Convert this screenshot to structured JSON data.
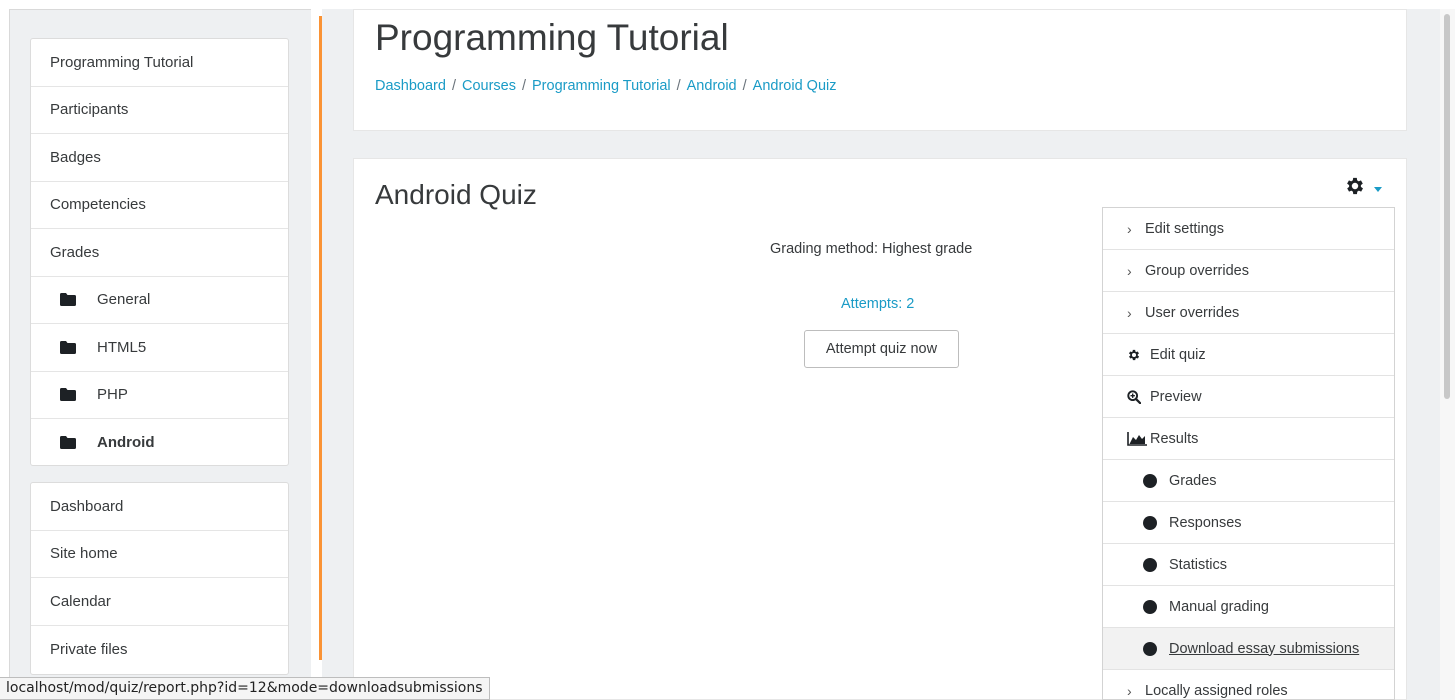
{
  "sidebar": {
    "course_items": [
      {
        "label": "Programming Tutorial",
        "type": "link"
      },
      {
        "label": "Participants",
        "type": "link"
      },
      {
        "label": "Badges",
        "type": "link"
      },
      {
        "label": "Competencies",
        "type": "link"
      },
      {
        "label": "Grades",
        "type": "link"
      },
      {
        "label": "General",
        "type": "folder"
      },
      {
        "label": "HTML5",
        "type": "folder"
      },
      {
        "label": "PHP",
        "type": "folder"
      },
      {
        "label": "Android",
        "type": "folder",
        "active": true
      }
    ],
    "site_items": [
      {
        "label": "Dashboard"
      },
      {
        "label": "Site home"
      },
      {
        "label": "Calendar"
      },
      {
        "label": "Private files"
      }
    ]
  },
  "header": {
    "title": "Programming Tutorial",
    "breadcrumb": [
      "Dashboard",
      "Courses",
      "Programming Tutorial",
      "Android",
      "Android Quiz"
    ],
    "separator": "/"
  },
  "quiz": {
    "title": "Android Quiz",
    "grading_method": "Grading method: Highest grade",
    "attempts": "Attempts: 2",
    "attempt_button": "Attempt quiz now"
  },
  "action_menu": {
    "gear_icon": "gear-icon",
    "items": [
      {
        "label": "Edit settings",
        "icon": "chevron-right"
      },
      {
        "label": "Group overrides",
        "icon": "chevron-right"
      },
      {
        "label": "User overrides",
        "icon": "chevron-right"
      },
      {
        "label": "Edit quiz",
        "icon": "gear"
      },
      {
        "label": "Preview",
        "icon": "magnifier-plus"
      },
      {
        "label": "Results",
        "icon": "area-chart"
      },
      {
        "label": "Grades",
        "icon": "dot",
        "sub": true
      },
      {
        "label": "Responses",
        "icon": "dot",
        "sub": true
      },
      {
        "label": "Statistics",
        "icon": "dot",
        "sub": true
      },
      {
        "label": "Manual grading",
        "icon": "dot",
        "sub": true
      },
      {
        "label": "Download essay submissions",
        "icon": "dot",
        "sub": true,
        "hover": true
      },
      {
        "label": "Locally assigned roles",
        "icon": "chevron-right"
      }
    ]
  },
  "status_bar": {
    "url": "localhost/mod/quiz/report.php?id=12&mode=downloadsubmissions"
  },
  "colors": {
    "accent_link": "#1a9bc6",
    "divider_orange": "#f98012",
    "page_bg": "#eef0f2"
  }
}
